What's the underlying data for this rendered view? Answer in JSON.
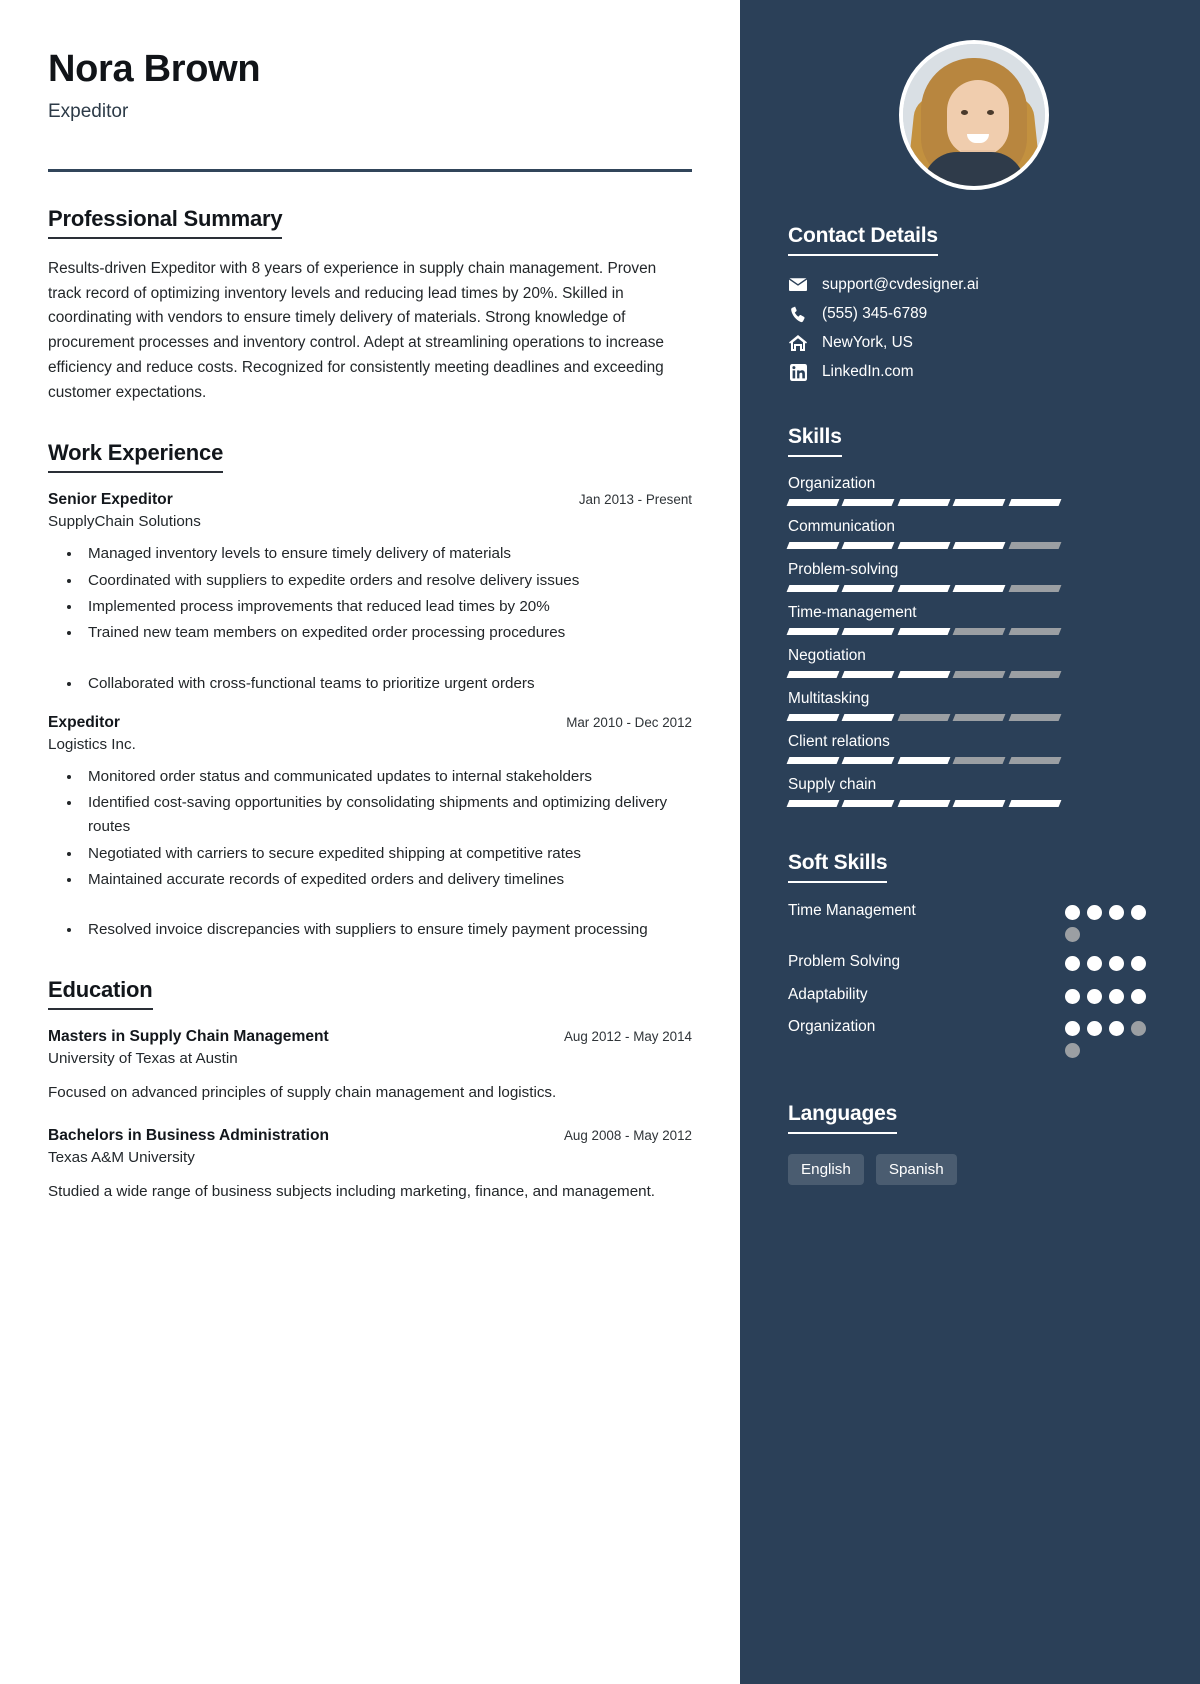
{
  "profile": {
    "name": "Nora Brown",
    "title": "Expeditor"
  },
  "sections": {
    "summary_title": "Professional Summary",
    "summary_text": "Results-driven Expeditor with 8 years of experience in supply chain management. Proven track record of optimizing inventory levels and reducing lead times by 20%. Skilled in coordinating with vendors to ensure timely delivery of materials. Strong knowledge of procurement processes and inventory control. Adept at streamlining operations to increase efficiency and reduce costs. Recognized for consistently meeting deadlines and exceeding customer expectations.",
    "work_title": "Work Experience",
    "education_title": "Education"
  },
  "work": [
    {
      "role": "Senior Expeditor",
      "date": "Jan 2013 - Present",
      "org": "SupplyChain Solutions",
      "points": [
        "Managed inventory levels to ensure timely delivery of materials",
        "Coordinated with suppliers to expedite orders and resolve delivery issues",
        "Implemented process improvements that reduced lead times by 20%",
        "Trained new team members on expedited order processing procedures",
        "Collaborated with cross-functional teams to prioritize urgent orders"
      ]
    },
    {
      "role": "Expeditor",
      "date": "Mar 2010 - Dec 2012",
      "org": "Logistics Inc.",
      "points": [
        "Monitored order status and communicated updates to internal stakeholders",
        "Identified cost-saving opportunities by consolidating shipments and optimizing delivery routes",
        "Negotiated with carriers to secure expedited shipping at competitive rates",
        "Maintained accurate records of expedited orders and delivery timelines",
        "Resolved invoice discrepancies with suppliers to ensure timely payment processing"
      ]
    }
  ],
  "education": [
    {
      "degree": "Masters in Supply Chain Management",
      "date": "Aug 2012 - May 2014",
      "school": "University of Texas at Austin",
      "description": "Focused on advanced principles of supply chain management and logistics."
    },
    {
      "degree": "Bachelors in Business Administration",
      "date": "Aug 2008 - May 2012",
      "school": "Texas A&M University",
      "description": "Studied a wide range of business subjects including marketing, finance, and management."
    }
  ],
  "sidebar": {
    "contact_title": "Contact Details",
    "contact": [
      {
        "icon": "envelope-icon",
        "value": "support@cvdesigner.ai"
      },
      {
        "icon": "phone-icon",
        "value": "(555) 345-6789"
      },
      {
        "icon": "home-icon",
        "value": "NewYork, US"
      },
      {
        "icon": "linkedin-icon",
        "value": "LinkedIn.com"
      }
    ],
    "skills_title": "Skills",
    "skills": [
      {
        "label": "Organization",
        "segments": 5,
        "filled": 5
      },
      {
        "label": "Communication",
        "segments": 5,
        "filled": 4
      },
      {
        "label": "Problem-solving",
        "segments": 5,
        "filled": 4
      },
      {
        "label": "Time-management",
        "segments": 5,
        "filled": 3
      },
      {
        "label": "Negotiation",
        "segments": 5,
        "filled": 3
      },
      {
        "label": "Multitasking",
        "segments": 5,
        "filled": 2
      },
      {
        "label": "Client relations",
        "segments": 5,
        "filled": 3
      },
      {
        "label": "Supply chain",
        "segments": 5,
        "filled": 5
      }
    ],
    "soft_skills_title": "Soft Skills",
    "soft_skills": [
      {
        "label": "Time Management",
        "total": 5,
        "filled": 4
      },
      {
        "label": "Problem Solving",
        "total": 4,
        "filled": 4
      },
      {
        "label": "Adaptability",
        "total": 4,
        "filled": 4
      },
      {
        "label": "Organization",
        "total": 5,
        "filled": 3
      }
    ],
    "languages_title": "Languages",
    "languages": [
      "English",
      "Spanish"
    ]
  },
  "colors": {
    "sidebar_bg": "#2b4058",
    "rule": "#31455a",
    "chip_bg": "#4a5c70",
    "muted_bar": "#9b9fa3"
  }
}
